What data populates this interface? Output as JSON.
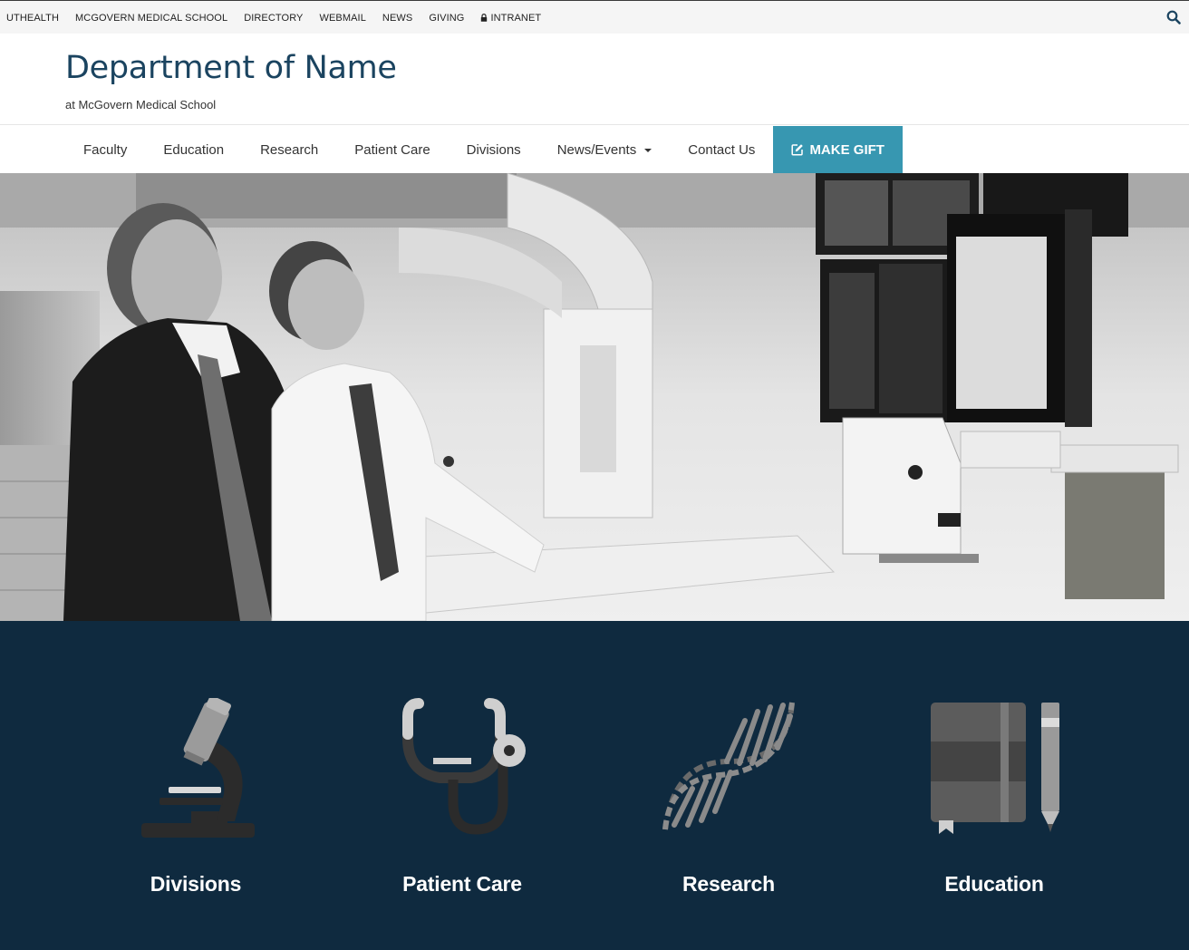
{
  "utility": {
    "links": [
      {
        "label": "UTHEALTH"
      },
      {
        "label": "MCGOVERN MEDICAL SCHOOL"
      },
      {
        "label": "DIRECTORY"
      },
      {
        "label": "WEBMAIL"
      },
      {
        "label": "NEWS"
      },
      {
        "label": "GIVING"
      },
      {
        "label": "INTRANET",
        "icon": "lock-icon"
      }
    ],
    "search_icon": "search-icon"
  },
  "header": {
    "title": "Department of Name",
    "subtitle": "at McGovern Medical School"
  },
  "nav": {
    "items": [
      {
        "label": "Faculty"
      },
      {
        "label": "Education"
      },
      {
        "label": "Research"
      },
      {
        "label": "Patient Care"
      },
      {
        "label": "Divisions"
      },
      {
        "label": "News/Events",
        "dropdown": true
      },
      {
        "label": "Contact Us"
      }
    ],
    "gift": {
      "label": "MAKE GIFT",
      "icon": "edit-icon"
    }
  },
  "quick_links": [
    {
      "label": "Divisions",
      "icon": "microscope-icon"
    },
    {
      "label": "Patient Care",
      "icon": "stethoscope-icon"
    },
    {
      "label": "Research",
      "icon": "dna-icon"
    },
    {
      "label": "Education",
      "icon": "notebook-pencil-icon"
    }
  ],
  "colors": {
    "title": "#1b4460",
    "accent": "#3797b1",
    "quick_links_bg": "#0f2a3f"
  }
}
